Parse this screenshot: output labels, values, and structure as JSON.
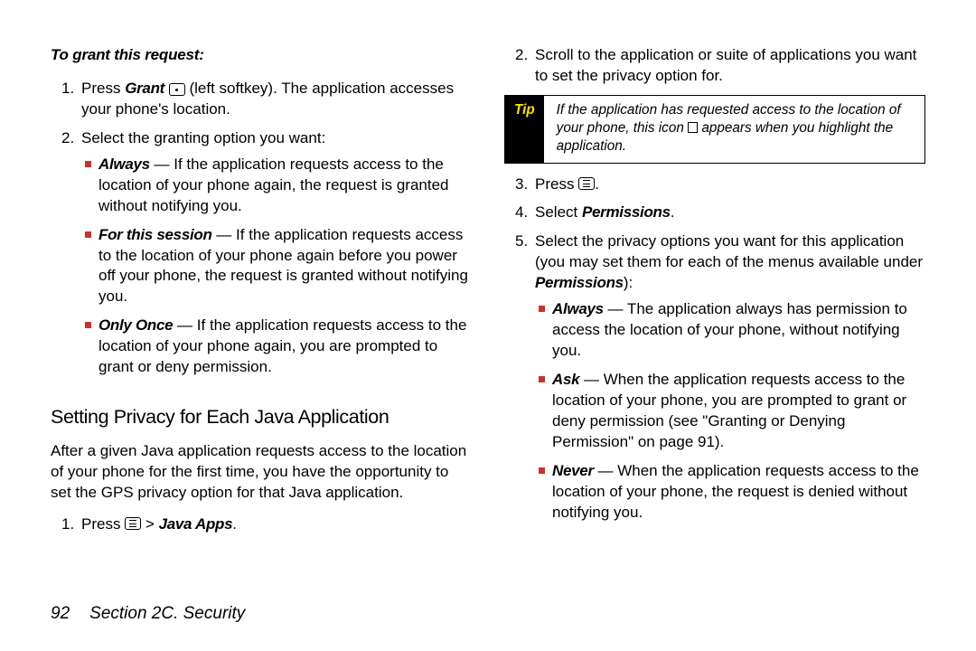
{
  "left": {
    "lead": "To grant this request:",
    "step1_a": "Press ",
    "step1_grant": "Grant",
    "step1_b": " (left softkey). The application accesses your phone's location.",
    "step2": "Select the granting option you want:",
    "opt_always_label": "Always",
    "opt_always_body": " — If the application requests access to the location of your phone again, the request is granted without notifying you.",
    "opt_session_label": "For this session",
    "opt_session_body": " — If the application requests access to the location of your phone again before you power off your phone, the request is granted without notifying you.",
    "opt_once_label": "Only Once",
    "opt_once_body": " — If the application requests access to the location of your phone again, you are prompted to grant or deny permission.",
    "heading": "Setting Privacy for Each Java Application",
    "para": "After a given Java application requests access to the location of your phone for the first time, you have the opportunity to set the GPS privacy option for that Java application.",
    "b_step1_a": "Press ",
    "b_step1_b": " > ",
    "b_step1_apps": "Java Apps",
    "b_step1_c": "."
  },
  "right": {
    "step2": "Scroll to the application or suite of applications you want to set the privacy option for.",
    "tip_label": "Tip",
    "tip_a": "If the application has requested access to the location of your phone, this icon ",
    "tip_b": " appears when you highlight the application.",
    "step3_a": "Press ",
    "step3_b": ".",
    "step4_a": "Select ",
    "step4_b": "Permissions",
    "step4_c": ".",
    "step5_a": "Select the privacy options you want for this application (you may set them for each of the menus available under ",
    "step5_b": "Permissions",
    "step5_c": "):",
    "opt_always_label": "Always",
    "opt_always_body": " — The application always has permission to access the location of your phone, without notifying you.",
    "opt_ask_label": "Ask",
    "opt_ask_body": " — When the application requests access to the location of your phone, you are prompted to grant or deny permission (see \"Granting or Denying Permission\" on page 91).",
    "opt_never_label": "Never",
    "opt_never_body": " — When the application requests access to the location of your phone, the request is denied without notifying you."
  },
  "footer": {
    "page": "92",
    "section": "Section 2C. Security"
  }
}
